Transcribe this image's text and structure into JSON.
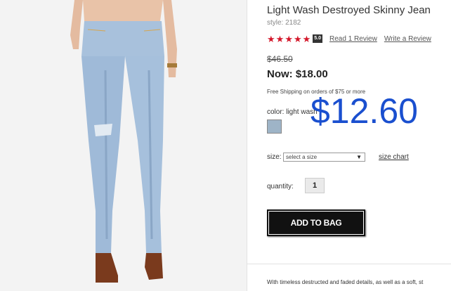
{
  "product": {
    "title": "Light Wash Destroyed Skinny Jean",
    "style": "style: 2182",
    "rating_value": "5.0",
    "rating_stars": 5,
    "read_reviews": "Read 1 Review",
    "write_review": "Write a Review",
    "old_price": "$46.50",
    "now_price": "Now: $18.00",
    "shipping": "Free Shipping on orders of $75 or more",
    "color_label": "color: light wash",
    "swatch_color": "#9eb4c7",
    "overlay_price": "$12.60",
    "size_label": "size:",
    "size_select_value": "select a size",
    "size_chart": "size chart",
    "quantity_label": "quantity:",
    "quantity_value": "1",
    "add_to_bag": "ADD TO BAG",
    "description": "With timeless destructed and faded details, as well as a soft, st"
  },
  "colors": {
    "star": "#d4172a",
    "overlay_price": "#1a4fcf",
    "button": "#111111"
  },
  "icons": [
    "star-icon",
    "dropdown-arrow-icon"
  ]
}
